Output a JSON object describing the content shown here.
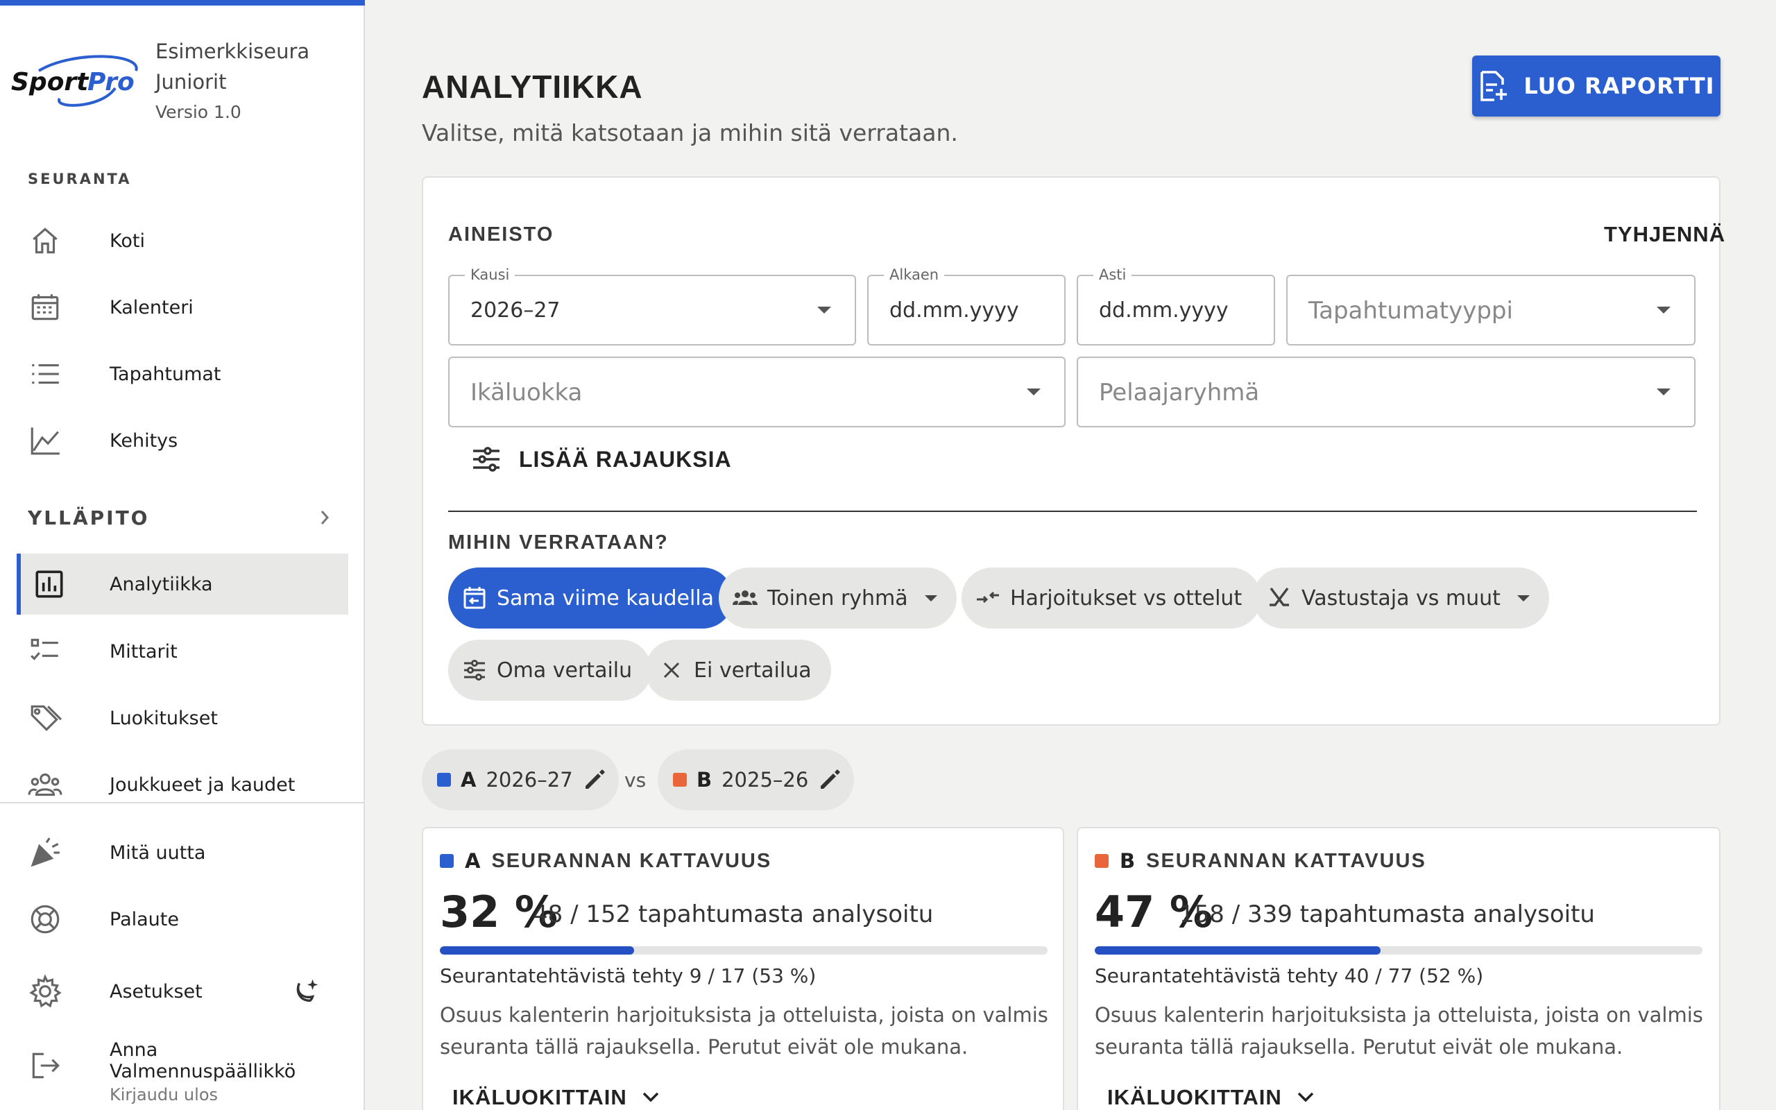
{
  "sidebar": {
    "brand": {
      "logo_text": "SportPro",
      "org_line1": "Esimerkkiseura",
      "org_line2": "Juniorit",
      "version": "Versio 1.0"
    },
    "section_seuranta": "SEURANTA",
    "seuranta_items": [
      {
        "label": "Koti",
        "icon": "home-icon"
      },
      {
        "label": "Kalenteri",
        "icon": "calendar-icon"
      },
      {
        "label": "Tapahtumat",
        "icon": "list-icon"
      },
      {
        "label": "Kehitys",
        "icon": "chart-line-icon"
      }
    ],
    "section_yllapito": "YLLÄPITO",
    "yllapito_items": [
      {
        "label": "Analytiikka",
        "icon": "analytics-icon",
        "active": true
      },
      {
        "label": "Mittarit",
        "icon": "checklist-icon"
      },
      {
        "label": "Luokitukset",
        "icon": "tags-icon"
      },
      {
        "label": "Joukkueet ja kaudet",
        "icon": "groups-icon"
      }
    ],
    "bottom_items": [
      {
        "label": "Mitä uutta",
        "icon": "celebration-icon"
      },
      {
        "label": "Palaute",
        "icon": "lifebuoy-icon"
      },
      {
        "label": "Asetukset",
        "icon": "gear-icon"
      }
    ],
    "user": {
      "name": "Anna Valmennuspäällikkö",
      "logout": "Kirjaudu ulos"
    }
  },
  "header": {
    "title": "ANALYTIIKKA",
    "subtitle": "Valitse, mitä katsotaan ja mihin sitä verrataan.",
    "report_button": "LUO RAPORTTI"
  },
  "filters": {
    "section_label": "AINEISTO",
    "clear_label": "TYHJENNÄ",
    "season": {
      "label": "Kausi",
      "value": "2026–27"
    },
    "from": {
      "label": "Alkaen",
      "value": "dd.mm.yyyy"
    },
    "to": {
      "label": "Asti",
      "value": "dd.mm.yyyy"
    },
    "event_type": {
      "placeholder": "Tapahtumatyyppi"
    },
    "age_class": {
      "placeholder": "Ikäluokka"
    },
    "player_group": {
      "placeholder": "Pelaajaryhmä"
    },
    "more_filters": "LISÄÄ RAJAUKSIA"
  },
  "comparison": {
    "label": "MIHIN VERRATAAN?",
    "options": [
      {
        "label": "Sama viime kaudella",
        "active": true
      },
      {
        "label": "Toinen ryhmä",
        "dropdown": true
      },
      {
        "label": "Harjoitukset vs ottelut"
      },
      {
        "label": "Vastustaja vs muut",
        "dropdown": true
      },
      {
        "label": "Oma vertailu"
      },
      {
        "label": "Ei vertailua"
      }
    ]
  },
  "series": {
    "a": {
      "letter": "A",
      "value": "2026–27",
      "color": "#2b5fd0"
    },
    "vs": "vs",
    "b": {
      "letter": "B",
      "value": "2025–26",
      "color": "#e8663a"
    }
  },
  "coverage": [
    {
      "letter": "A",
      "title": "SEURANNAN KATTAVUUS",
      "percent": "32 %",
      "fraction": 0.32,
      "events": "48 / 152 tapahtumasta analysoitu",
      "tasks": "Seurantatehtävistä tehty 9 / 17 (53 %)",
      "description": "Osuus kalenterin harjoituksista ja otteluista, joista on valmis seuranta tällä rajauksella. Perutut eivät ole mukana.",
      "expand": "IKÄLUOKITTAIN"
    },
    {
      "letter": "B",
      "title": "SEURANNAN KATTAVUUS",
      "percent": "47 %",
      "fraction": 0.47,
      "events": "158 / 339 tapahtumasta analysoitu",
      "tasks": "Seurantatehtävistä tehty 40 / 77 (52 %)",
      "description": "Osuus kalenterin harjoituksista ja otteluista, joista on valmis seuranta tällä rajauksella. Perutut eivät ole mukana.",
      "expand": "IKÄLUOKITTAIN"
    }
  ]
}
